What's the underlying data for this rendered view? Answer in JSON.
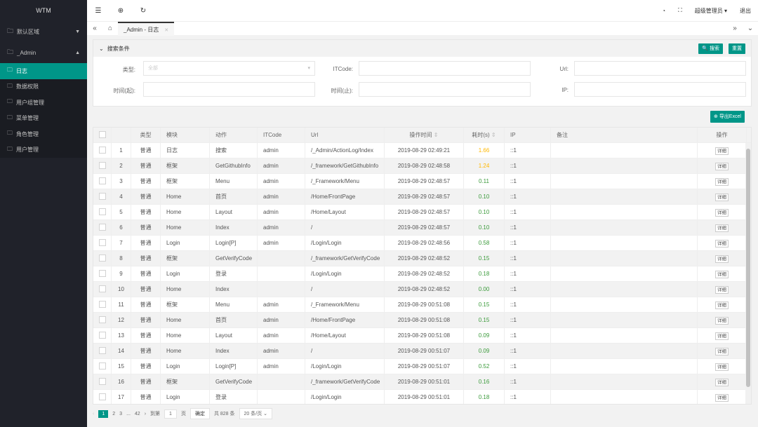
{
  "app": {
    "title": "WTM"
  },
  "sidebar": {
    "groups": [
      {
        "label": "默认区域"
      },
      {
        "label": "_Admin"
      }
    ],
    "items": [
      {
        "label": "日志"
      },
      {
        "label": "数据权限"
      },
      {
        "label": "用户组管理"
      },
      {
        "label": "菜单管理"
      },
      {
        "label": "角色管理"
      },
      {
        "label": "用户管理"
      }
    ]
  },
  "header": {
    "user": "超级管理员",
    "logout": "退出"
  },
  "tabs": [
    {
      "label": "_Admin - 日志"
    }
  ],
  "search": {
    "title": "搜索条件",
    "search_btn": "搜索",
    "reset_btn": "重置",
    "type_label": "类型:",
    "type_value": "全部",
    "itcode_label": "ITCode:",
    "url_label": "Url:",
    "start_label": "时间(起):",
    "end_label": "时间(止):",
    "ip_label": "IP:"
  },
  "export_btn": "导出Excel",
  "table": {
    "headers": [
      "",
      "类型",
      "模块",
      "动作",
      "ITCode",
      "Url",
      "操作时间",
      "耗时(s)",
      "IP",
      "备注",
      "操作"
    ],
    "detail_label": "详细",
    "rows": [
      [
        "1",
        "普通",
        "日志",
        "搜索",
        "admin",
        "/_Admin/ActionLog/Index",
        "2019-08-29 02:49:21",
        "1.66",
        "::1"
      ],
      [
        "2",
        "普通",
        "框架",
        "GetGithubInfo",
        "admin",
        "/_framework/GetGithubInfo",
        "2019-08-29 02:48:58",
        "1.24",
        "::1"
      ],
      [
        "3",
        "普通",
        "框架",
        "Menu",
        "admin",
        "/_Framework/Menu",
        "2019-08-29 02:48:57",
        "0.11",
        "::1"
      ],
      [
        "4",
        "普通",
        "Home",
        "首页",
        "admin",
        "/Home/FrontPage",
        "2019-08-29 02:48:57",
        "0.10",
        "::1"
      ],
      [
        "5",
        "普通",
        "Home",
        "Layout",
        "admin",
        "/Home/Layout",
        "2019-08-29 02:48:57",
        "0.10",
        "::1"
      ],
      [
        "6",
        "普通",
        "Home",
        "Index",
        "admin",
        "/",
        "2019-08-29 02:48:57",
        "0.10",
        "::1"
      ],
      [
        "7",
        "普通",
        "Login",
        "Login[P]",
        "admin",
        "/Login/Login",
        "2019-08-29 02:48:56",
        "0.58",
        "::1"
      ],
      [
        "8",
        "普通",
        "框架",
        "GetVerifyCode",
        "",
        "/_framework/GetVerifyCode",
        "2019-08-29 02:48:52",
        "0.15",
        "::1"
      ],
      [
        "9",
        "普通",
        "Login",
        "登录",
        "",
        "/Login/Login",
        "2019-08-29 02:48:52",
        "0.18",
        "::1"
      ],
      [
        "10",
        "普通",
        "Home",
        "Index",
        "",
        "/",
        "2019-08-29 02:48:52",
        "0.00",
        "::1"
      ],
      [
        "11",
        "普通",
        "框架",
        "Menu",
        "admin",
        "/_Framework/Menu",
        "2019-08-29 00:51:08",
        "0.15",
        "::1"
      ],
      [
        "12",
        "普通",
        "Home",
        "首页",
        "admin",
        "/Home/FrontPage",
        "2019-08-29 00:51:08",
        "0.15",
        "::1"
      ],
      [
        "13",
        "普通",
        "Home",
        "Layout",
        "admin",
        "/Home/Layout",
        "2019-08-29 00:51:08",
        "0.09",
        "::1"
      ],
      [
        "14",
        "普通",
        "Home",
        "Index",
        "admin",
        "/",
        "2019-08-29 00:51:07",
        "0.09",
        "::1"
      ],
      [
        "15",
        "普通",
        "Login",
        "Login[P]",
        "admin",
        "/Login/Login",
        "2019-08-29 00:51:07",
        "0.52",
        "::1"
      ],
      [
        "16",
        "普通",
        "框架",
        "GetVerifyCode",
        "",
        "/_framework/GetVerifyCode",
        "2019-08-29 00:51:01",
        "0.16",
        "::1"
      ],
      [
        "17",
        "普通",
        "Login",
        "登录",
        "",
        "/Login/Login",
        "2019-08-29 00:51:01",
        "0.18",
        "::1"
      ]
    ]
  },
  "pagination": {
    "pages": [
      "1",
      "2",
      "3",
      "...",
      "42"
    ],
    "goto_label": "到第",
    "goto_value": "1",
    "page_unit": "页",
    "confirm": "确定",
    "total": "共 828 条",
    "page_size": "20 条/页"
  },
  "colors": {
    "accent": "#009688",
    "slow": "#FFB800",
    "fast": "#5FB878"
  }
}
